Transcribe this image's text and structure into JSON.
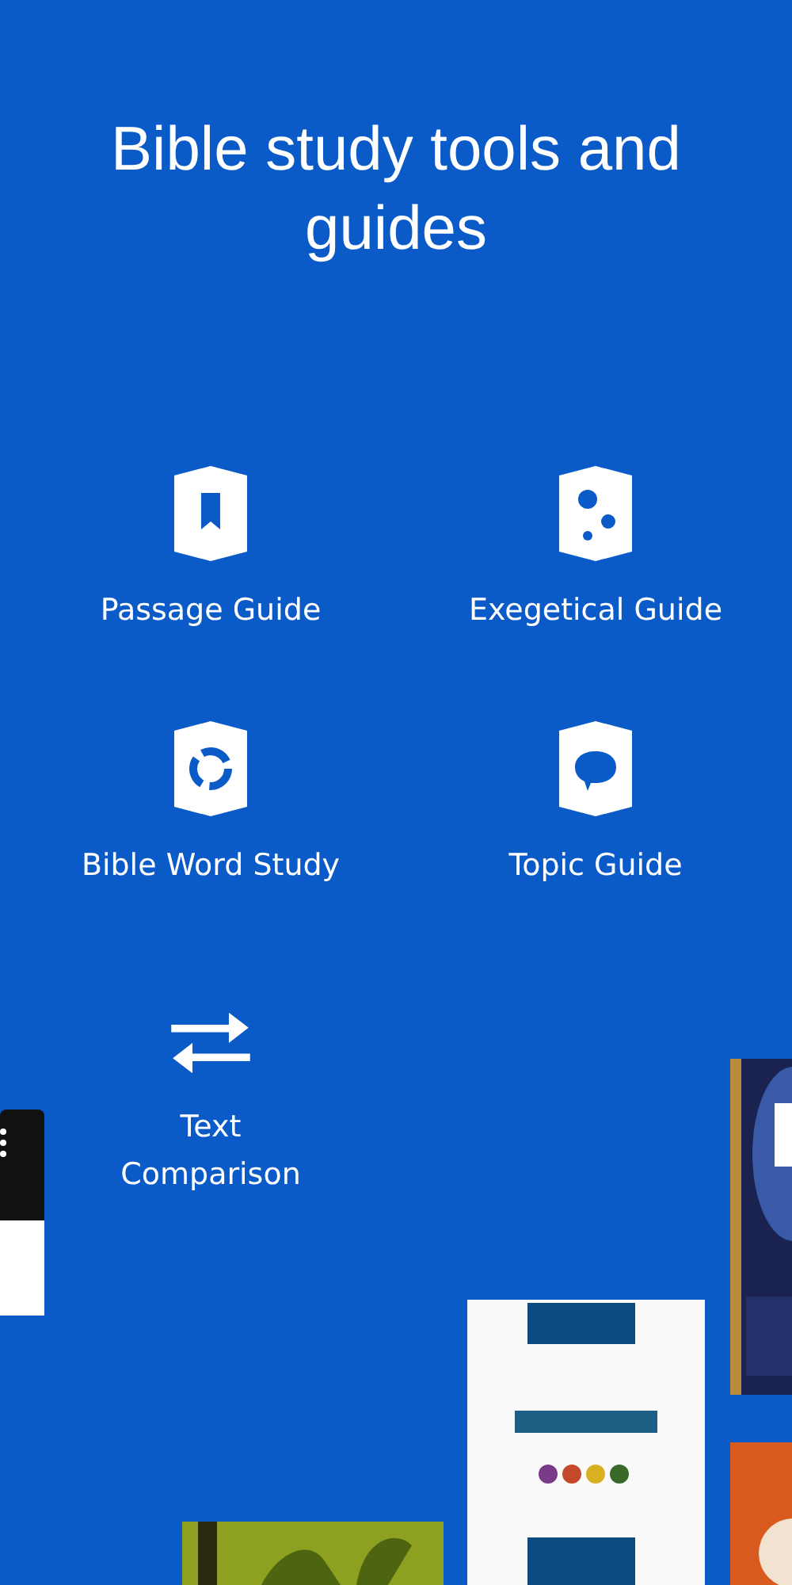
{
  "title": "Bible study tools and guides",
  "features": [
    {
      "kind": "bookmark",
      "label": "Passage Guide"
    },
    {
      "kind": "bubbles",
      "label": "Exegetical Guide"
    },
    {
      "kind": "ring",
      "label": "Bible Word Study"
    },
    {
      "kind": "speech",
      "label": "Topic Guide"
    },
    {
      "kind": "arrows",
      "label": "Text Comparison"
    }
  ]
}
